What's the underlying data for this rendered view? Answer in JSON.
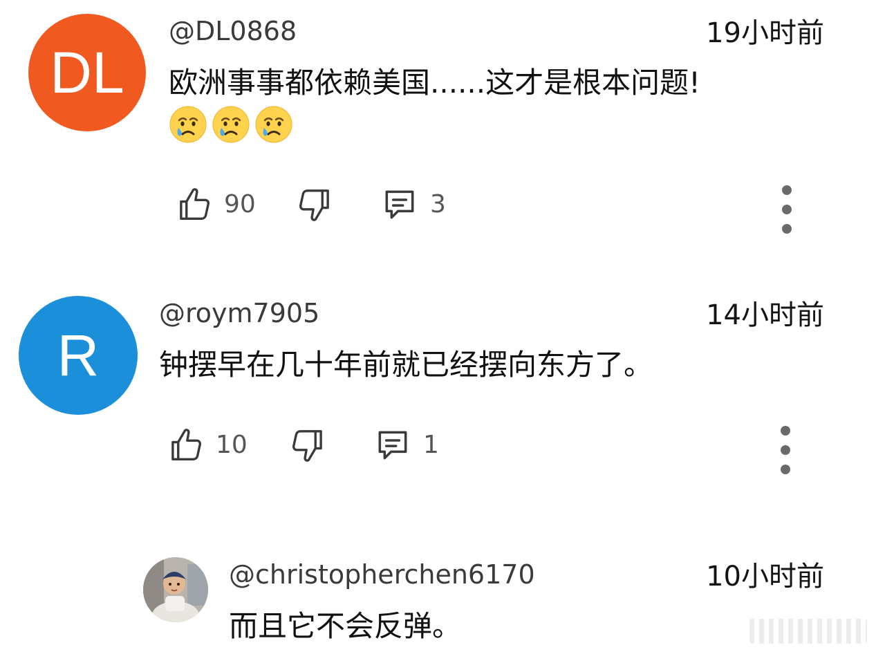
{
  "comments": [
    {
      "avatar_initials": "DL",
      "avatar_color": "#f0591f",
      "handle": "@DL0868",
      "time": "19小时前",
      "text": "欧洲事事都依赖美国......这才是根本问题!",
      "emojis": [
        "crying-face",
        "crying-face",
        "crying-face"
      ],
      "likes": "90",
      "replies": "3"
    },
    {
      "avatar_initials": "R",
      "avatar_color": "#1b8fd9",
      "handle": "@roym7905",
      "time": "14小时前",
      "text": "钟摆早在几十年前就已经摆向东方了。",
      "likes": "10",
      "replies": "1"
    },
    {
      "avatar_type": "photo",
      "handle": "@christopherchen6170",
      "time": "10小时前",
      "text": "而且它不会反弹。"
    }
  ],
  "icons": {
    "like": "thumbs-up-icon",
    "dislike": "thumbs-down-icon",
    "reply": "reply-comment-icon",
    "more": "more-vertical-icon"
  }
}
